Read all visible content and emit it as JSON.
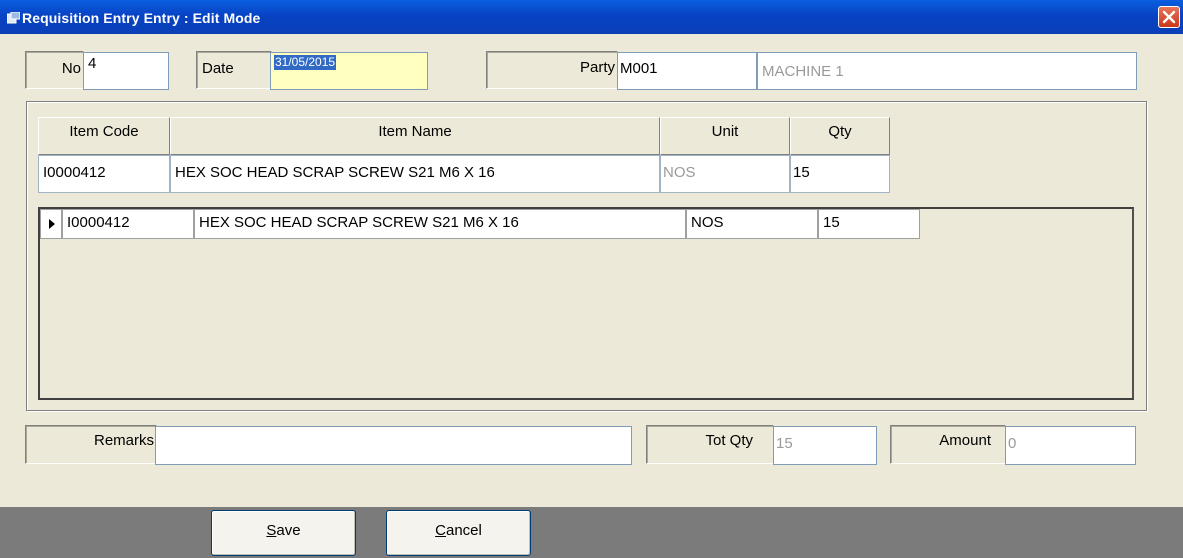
{
  "window": {
    "title": "Requisition Entry Entry : Edit Mode"
  },
  "header": {
    "no_label": "No",
    "no_value": "4",
    "date_label": "Date",
    "date_value": "31/05/2015",
    "party_label": "Party",
    "party_code": "M001",
    "party_name": "MACHINE 1"
  },
  "entry": {
    "columns": [
      "Item Code",
      "Item Name",
      "Unit",
      "Qty"
    ],
    "item_code": "I0000412",
    "item_name": "HEX SOC HEAD SCRAP SCREW S21 M6 X 16",
    "unit": "NOS",
    "qty": "15"
  },
  "grid": {
    "rows": [
      {
        "item_code": "I0000412",
        "item_name": "HEX SOC HEAD SCRAP SCREW S21 M6 X 16",
        "unit": "NOS",
        "qty": "15"
      }
    ]
  },
  "footer": {
    "remarks_label": "Remarks",
    "remarks_value": "",
    "totqty_label": "Tot Qty",
    "totqty_value": "15",
    "amount_label": "Amount",
    "amount_value": "0"
  },
  "buttons": {
    "save_first": "S",
    "save_rest": "ave",
    "cancel_first": "C",
    "cancel_rest": "ancel"
  }
}
